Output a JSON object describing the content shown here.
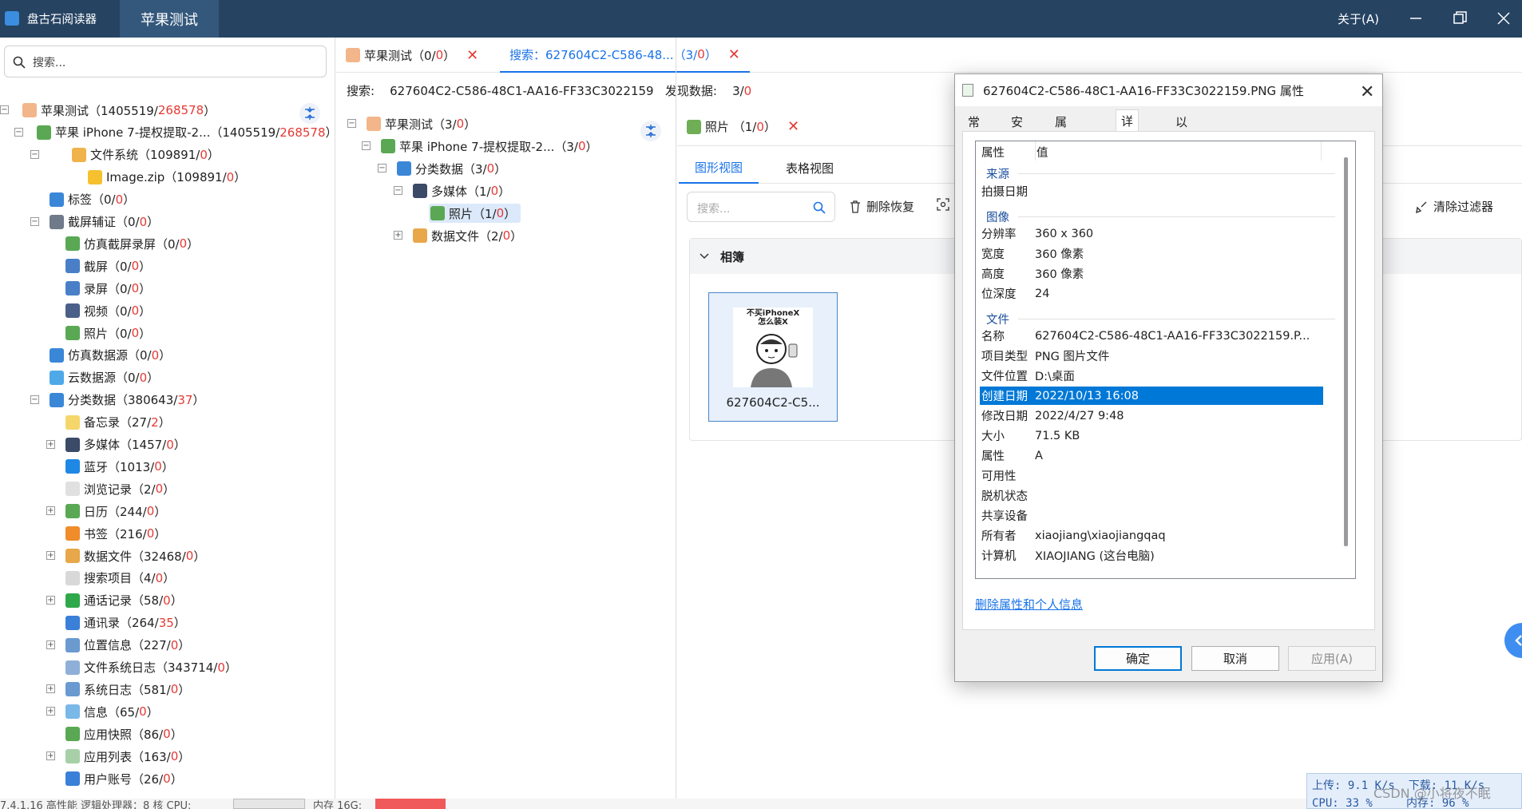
{
  "app": {
    "name": "盘古石阅读器",
    "case_tab": "苹果测试",
    "about": "关于(A)"
  },
  "left_panel": {
    "search_placeholder": "搜索...",
    "tree": [
      {
        "label": "苹果测试（1405519/",
        "red": "268578",
        "tail": "）"
      },
      {
        "label": "苹果 iPhone 7-提权提取-2...（1405519/",
        "red": "268578",
        "tail": "）"
      },
      {
        "label": "文件系统（109891/",
        "red": "0",
        "tail": "）"
      },
      {
        "label": "Image.zip（109891/",
        "red": "0",
        "tail": "）"
      },
      {
        "label": "标签（0/",
        "red": "0",
        "tail": "）"
      },
      {
        "label": "截屏辅证（0/",
        "red": "0",
        "tail": "）"
      },
      {
        "label": "仿真截屏录屏（0/",
        "red": "0",
        "tail": "）"
      },
      {
        "label": "截屏（0/",
        "red": "0",
        "tail": "）"
      },
      {
        "label": "录屏（0/",
        "red": "0",
        "tail": "）"
      },
      {
        "label": "视频（0/",
        "red": "0",
        "tail": "）"
      },
      {
        "label": "照片（0/",
        "red": "0",
        "tail": "）"
      },
      {
        "label": "仿真数据源（0/",
        "red": "0",
        "tail": "）"
      },
      {
        "label": "云数据源（0/",
        "red": "0",
        "tail": "）"
      },
      {
        "label": "分类数据（380643/",
        "red": "37",
        "tail": "）"
      },
      {
        "label": "备忘录（27/",
        "red": "2",
        "tail": "）"
      },
      {
        "label": "多媒体（1457/",
        "red": "0",
        "tail": "）"
      },
      {
        "label": "蓝牙（1013/",
        "red": "0",
        "tail": "）"
      },
      {
        "label": "浏览记录（2/",
        "red": "0",
        "tail": "）"
      },
      {
        "label": "日历（244/",
        "red": "0",
        "tail": "）"
      },
      {
        "label": "书签（216/",
        "red": "0",
        "tail": "）"
      },
      {
        "label": "数据文件（32468/",
        "red": "0",
        "tail": "）"
      },
      {
        "label": "搜索项目（4/",
        "red": "0",
        "tail": "）"
      },
      {
        "label": "通话记录（58/",
        "red": "0",
        "tail": "）"
      },
      {
        "label": "通讯录（264/",
        "red": "35",
        "tail": "）"
      },
      {
        "label": "位置信息（227/",
        "red": "0",
        "tail": "）"
      },
      {
        "label": "文件系统日志（343714/",
        "red": "0",
        "tail": "）"
      },
      {
        "label": "系统日志（581/",
        "red": "0",
        "tail": "）"
      },
      {
        "label": "信息（65/",
        "red": "0",
        "tail": "）"
      },
      {
        "label": "应用快照（86/",
        "red": "0",
        "tail": "）"
      },
      {
        "label": "应用列表（163/",
        "red": "0",
        "tail": "）"
      },
      {
        "label": "用户账号（26/",
        "red": "0",
        "tail": "）"
      }
    ]
  },
  "doc_tabs": [
    {
      "label": "苹果测试（0/",
      "red": "0",
      "tail": "）"
    },
    {
      "label": "搜索：627604C2-C586-48...（3/",
      "red": "0",
      "tail": "）"
    }
  ],
  "search_info": {
    "prefix": "搜索:",
    "query": "627604C2-C586-48C1-AA16-FF33C3022159",
    "found_label": "发现数据:",
    "found": "3",
    "sep": "/",
    "found_red": "0"
  },
  "mid_tree": [
    {
      "label": "苹果测试（3/",
      "red": "0",
      "tail": "）"
    },
    {
      "label": "苹果 iPhone 7-提权提取-2...（3/",
      "red": "0",
      "tail": "）"
    },
    {
      "label": "分类数据（3/",
      "red": "0",
      "tail": "）"
    },
    {
      "label": "多媒体（1/",
      "red": "0",
      "tail": "）"
    },
    {
      "label": "照片（1/",
      "red": "0",
      "tail": "）"
    },
    {
      "label": "数据文件（2/",
      "red": "0",
      "tail": "）"
    }
  ],
  "right_panel": {
    "tab": {
      "label": "照片 （1/",
      "red": "0",
      "tail": "）"
    },
    "views": [
      "图形视图",
      "表格视图"
    ],
    "filter_placeholder": "搜索...",
    "delete_recover": "删除恢复",
    "clear_filter": "清除过滤器",
    "album": "相簿",
    "thumb_caption": "627604C2-C5...",
    "thumb_text": [
      "不买iPhoneX",
      "怎么装X"
    ]
  },
  "dialog": {
    "title": "627604C2-C586-48C1-AA16-FF33C3022159.PNG 属性",
    "tabs": [
      "常规",
      "安全",
      "属性修改",
      "详细信息",
      "以前的版本"
    ],
    "col_prop": "属性",
    "col_val": "值",
    "groups": {
      "source": "来源",
      "image": "图像",
      "file": "文件"
    },
    "rows": {
      "taken": {
        "k": "拍摄日期",
        "v": ""
      },
      "res": {
        "k": "分辨率",
        "v": "360 x 360"
      },
      "width": {
        "k": "宽度",
        "v": "360 像素"
      },
      "height": {
        "k": "高度",
        "v": "360 像素"
      },
      "depth": {
        "k": "位深度",
        "v": "24"
      },
      "name": {
        "k": "名称",
        "v": "627604C2-C586-48C1-AA16-FF33C3022159.P..."
      },
      "type": {
        "k": "项目类型",
        "v": "PNG 图片文件"
      },
      "loc": {
        "k": "文件位置",
        "v": "D:\\桌面"
      },
      "created": {
        "k": "创建日期",
        "v": "2022/10/13 16:08"
      },
      "modified": {
        "k": "修改日期",
        "v": "2022/4/27 9:48"
      },
      "size": {
        "k": "大小",
        "v": "71.5 KB"
      },
      "attr": {
        "k": "属性",
        "v": "A"
      },
      "avail": {
        "k": "可用性",
        "v": ""
      },
      "offline": {
        "k": "脱机状态",
        "v": ""
      },
      "shared": {
        "k": "共享设备",
        "v": ""
      },
      "owner": {
        "k": "所有者",
        "v": "xiaojiang\\xiaojiangqaq"
      },
      "computer": {
        "k": "计算机",
        "v": "XIAOJIANG (这台电脑)"
      }
    },
    "remove_link": "删除属性和个人信息",
    "ok": "确定",
    "cancel": "取消",
    "apply": "应用(A)"
  },
  "status": {
    "text": "7.4.1.16  高性能  逻辑处理器：8 核  CPU:",
    "mem": "内存 16G:"
  },
  "net": {
    "up": "上传: 9.1 K/s",
    "down": "下载: 11 K/s",
    "cpu": "CPU: 33 %",
    "memv": "内存: 96 %"
  },
  "watermark": "CSDN @小将夜不眠",
  "colors": {
    "titlebar": "#264362",
    "accent": "#1a73e8",
    "highlight": "#e53935",
    "selection": "#0078d7"
  }
}
